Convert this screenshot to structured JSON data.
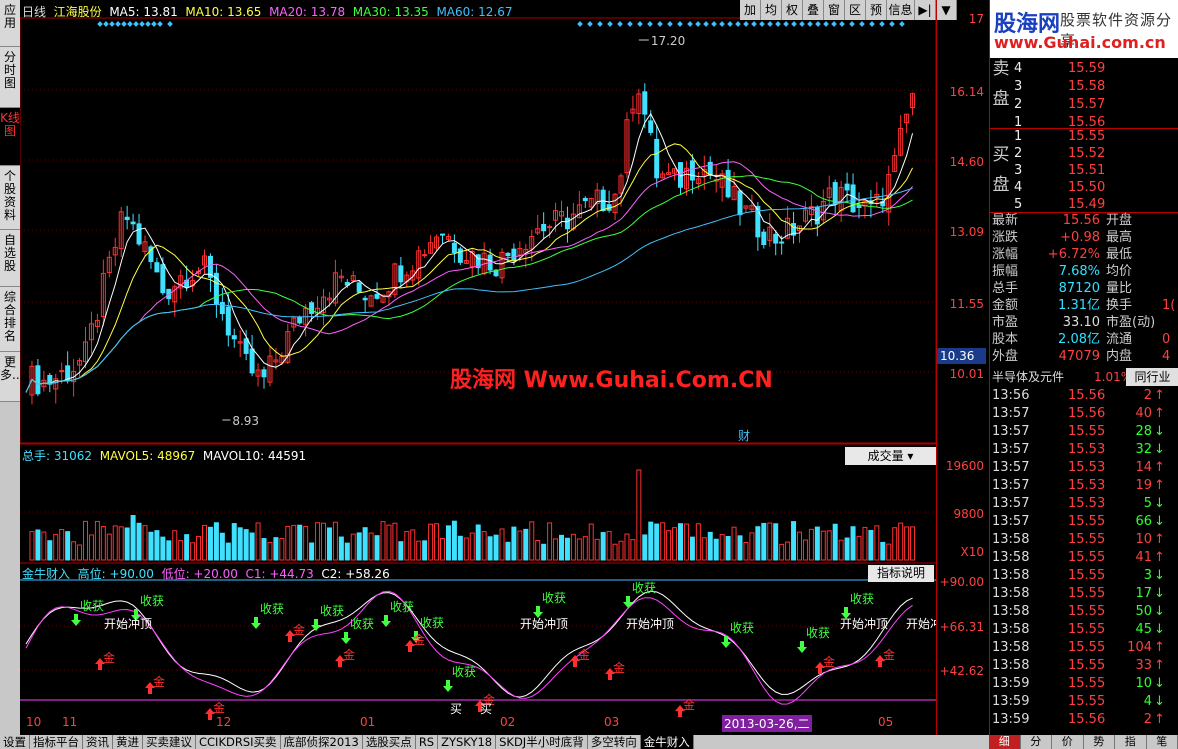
{
  "left_tabs": [
    "应用",
    "分时图",
    "K线图",
    "个股资料",
    "自选股",
    "综合排名",
    "更多..."
  ],
  "toolbar": [
    "加",
    "均",
    "权",
    "叠",
    "窗",
    "区",
    "预",
    "信息",
    "▶|",
    "▼"
  ],
  "legend_main": {
    "period": "日线",
    "stock": "江海股份",
    "ma5": "MA5: 13.81",
    "ma10": "MA10: 13.65",
    "ma20": "MA20: 13.78",
    "ma30": "MA30: 13.35",
    "ma60": "MA60: 12.67"
  },
  "legend_vol": {
    "v": "总手: 31062",
    "m5": "MAVOL5: 48967",
    "m10": "MAVOL10: 44591"
  },
  "legend_ind": {
    "name": "金牛财入",
    "hi": "高位: +90.00",
    "lo": "低位: +20.00",
    "c1": "C1: +44.73",
    "c2": "C2: +58.26"
  },
  "vol_dropdown": "成交量",
  "indicator_button": "指标说明",
  "watermark": "股海网 Www.Guhai.Com.CN",
  "price_axis": [
    "17",
    "16.14",
    "14.60",
    "13.09",
    "11.55",
    "10.01"
  ],
  "current_price_tag": "10.36",
  "vol_axis": [
    "19600",
    "9800",
    "X10"
  ],
  "ind_axis": [
    "+90.00",
    "+66.31",
    "+42.62"
  ],
  "annot": {
    "high": "17.20",
    "low": "8.93",
    "cai": "财"
  },
  "date_labels": [
    "10",
    "11",
    "12",
    "01",
    "02",
    "03",
    "2013-03-26,二",
    "05"
  ],
  "logo": {
    "name": "股海网",
    "slogan": "股票软件资源分享",
    "url": "www.Guhai.com.cn"
  },
  "orderbook": {
    "sell_label": [
      "卖",
      "盘"
    ],
    "buy_label": [
      "买",
      "盘"
    ],
    "sell": [
      {
        "n": "4",
        "p": "15.59"
      },
      {
        "n": "3",
        "p": "15.58"
      },
      {
        "n": "2",
        "p": "15.57"
      },
      {
        "n": "1",
        "p": "15.56"
      }
    ],
    "buy": [
      {
        "n": "1",
        "p": "15.55"
      },
      {
        "n": "2",
        "p": "15.52"
      },
      {
        "n": "3",
        "p": "15.51"
      },
      {
        "n": "4",
        "p": "15.50"
      },
      {
        "n": "5",
        "p": "15.49"
      }
    ]
  },
  "quote": [
    {
      "l1": "最新",
      "v1": "15.56",
      "l2": "开盘",
      "v2": "",
      "c": "#ff4040"
    },
    {
      "l1": "涨跌",
      "v1": "+0.98",
      "l2": "最高",
      "v2": "",
      "c": "#ff4040"
    },
    {
      "l1": "涨幅",
      "v1": "+6.72%",
      "l2": "最低",
      "v2": "",
      "c": "#ff4040"
    },
    {
      "l1": "振幅",
      "v1": "7.68%",
      "l2": "均价",
      "v2": "",
      "c": "#30e0ff"
    },
    {
      "l1": "总手",
      "v1": "87120",
      "l2": "量比",
      "v2": "",
      "c": "#30e0ff"
    },
    {
      "l1": "金额",
      "v1": "1.31亿",
      "l2": "换手",
      "v2": "1(",
      "c": "#30e0ff"
    },
    {
      "l1": "市盈",
      "v1": "33.10",
      "l2": "市盈(动)",
      "v2": "",
      "c": "#dddddd"
    },
    {
      "l1": "股本",
      "v1": "2.08亿",
      "l2": "流通",
      "v2": "0",
      "c": "#30e0ff"
    },
    {
      "l1": "外盘",
      "v1": "47079",
      "l2": "内盘",
      "v2": "4",
      "c": "#ff4040"
    }
  ],
  "sector": {
    "name": "半导体及元件",
    "pct": "1.01%",
    "btn": "同行业"
  },
  "trades": [
    {
      "t": "13:56",
      "p": "15.56",
      "v": "2",
      "a": "↑",
      "c": "#ff4040"
    },
    {
      "t": "13:57",
      "p": "15.56",
      "v": "40",
      "a": "↑",
      "c": "#ff4040"
    },
    {
      "t": "13:57",
      "p": "15.55",
      "v": "28",
      "a": "↓",
      "c": "#30ff30"
    },
    {
      "t": "13:57",
      "p": "15.53",
      "v": "32",
      "a": "↓",
      "c": "#30ff30"
    },
    {
      "t": "13:57",
      "p": "15.53",
      "v": "14",
      "a": "↑",
      "c": "#ff4040"
    },
    {
      "t": "13:57",
      "p": "15.53",
      "v": "19",
      "a": "↑",
      "c": "#ff4040"
    },
    {
      "t": "13:57",
      "p": "15.53",
      "v": "5",
      "a": "↓",
      "c": "#30ff30"
    },
    {
      "t": "13:57",
      "p": "15.55",
      "v": "66",
      "a": "↓",
      "c": "#30ff30"
    },
    {
      "t": "13:58",
      "p": "15.55",
      "v": "10",
      "a": "↑",
      "c": "#ff4040"
    },
    {
      "t": "13:58",
      "p": "15.55",
      "v": "41",
      "a": "↑",
      "c": "#ff4040"
    },
    {
      "t": "13:58",
      "p": "15.55",
      "v": "3",
      "a": "↓",
      "c": "#30ff30"
    },
    {
      "t": "13:58",
      "p": "15.55",
      "v": "17",
      "a": "↓",
      "c": "#30ff30"
    },
    {
      "t": "13:58",
      "p": "15.55",
      "v": "50",
      "a": "↓",
      "c": "#30ff30"
    },
    {
      "t": "13:58",
      "p": "15.55",
      "v": "45",
      "a": "↓",
      "c": "#30ff30"
    },
    {
      "t": "13:58",
      "p": "15.55",
      "v": "104",
      "a": "↑",
      "c": "#ff4040"
    },
    {
      "t": "13:58",
      "p": "15.55",
      "v": "33",
      "a": "↑",
      "c": "#ff4040"
    },
    {
      "t": "13:59",
      "p": "15.55",
      "v": "10",
      "a": "↓",
      "c": "#30ff30"
    },
    {
      "t": "13:59",
      "p": "15.55",
      "v": "4",
      "a": "↓",
      "c": "#30ff30"
    },
    {
      "t": "13:59",
      "p": "15.56",
      "v": "2",
      "a": "↑",
      "c": "#ff4040"
    }
  ],
  "bottom_tabs": [
    "设置",
    "指标平台",
    "资讯",
    "黄进",
    "买卖建议",
    "CCIKDRSI买卖",
    "底部侦探2013",
    "选股买点",
    "RS",
    "ZYSKY18",
    "SKDJ半小时底背",
    "多空转向",
    "金牛财入"
  ],
  "right_bottom_tabs": [
    "细",
    "分",
    "价",
    "势",
    "指",
    "笔"
  ],
  "signals": {
    "buy": "买",
    "gold": "金",
    "harvest": "收获",
    "top": "开始冲顶"
  }
}
